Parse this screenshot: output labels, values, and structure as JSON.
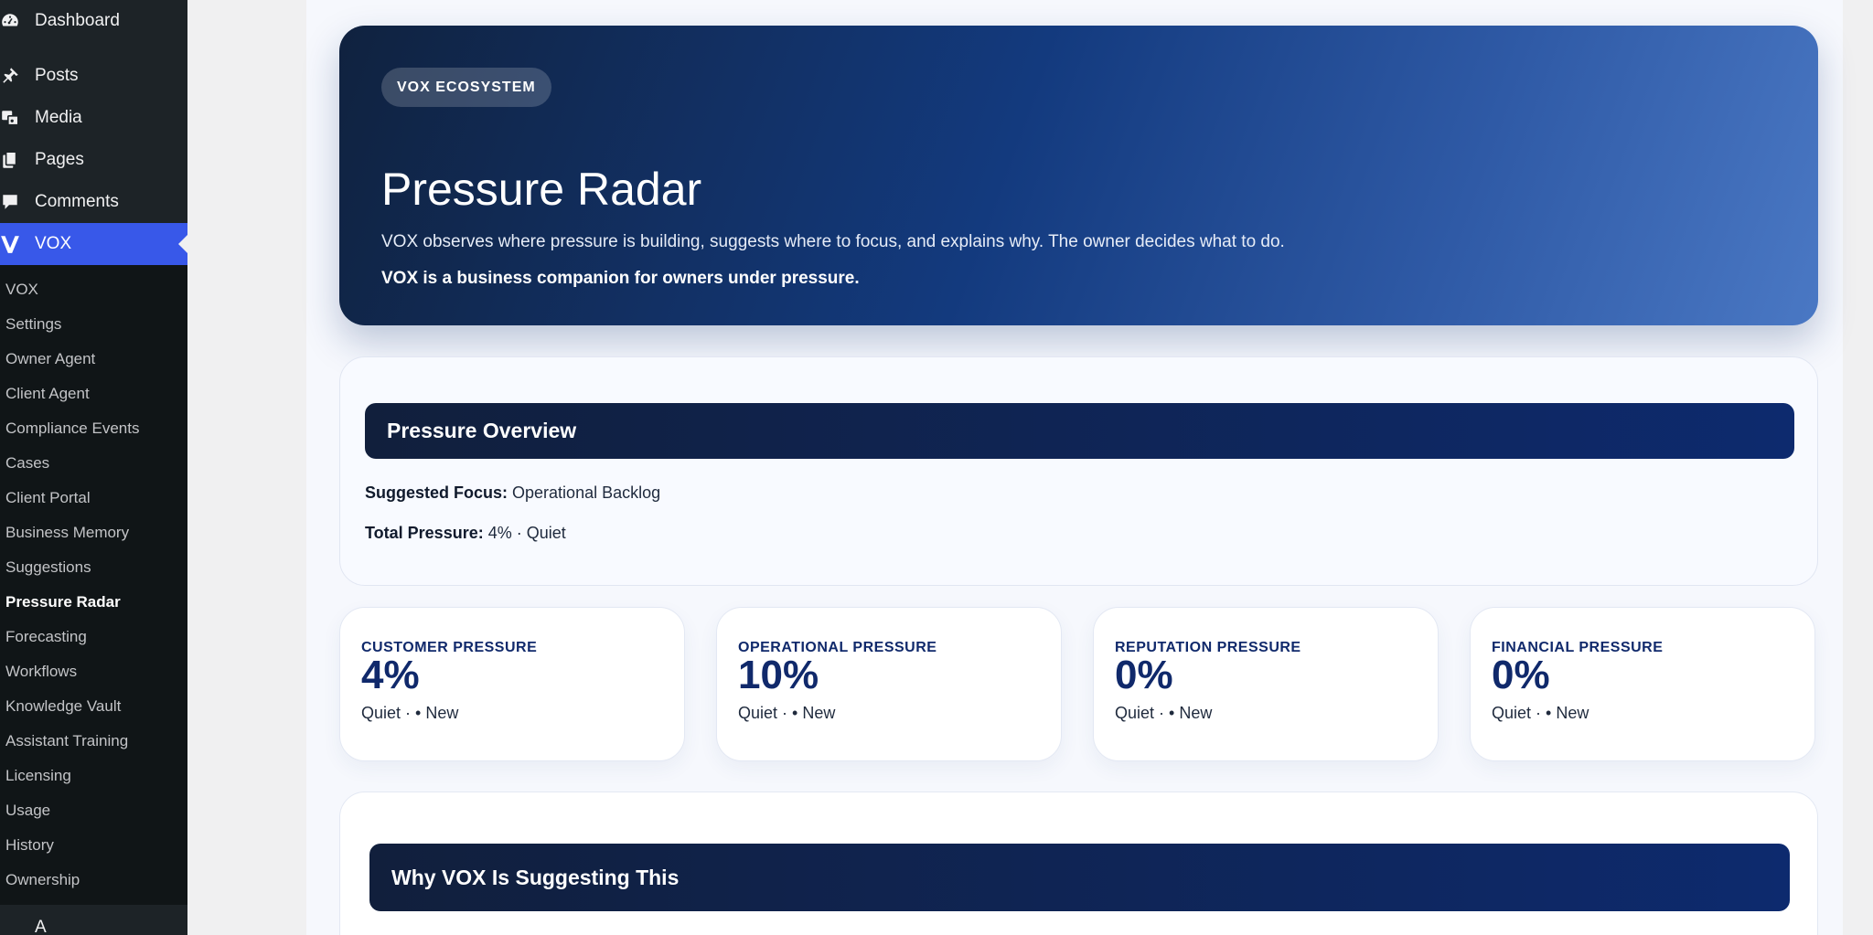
{
  "sidebar": {
    "top_items": [
      {
        "label": "Dashboard",
        "icon": "dashboard-icon"
      },
      {
        "label": "Posts",
        "icon": "pin-icon"
      },
      {
        "label": "Media",
        "icon": "media-icon"
      },
      {
        "label": "Pages",
        "icon": "pages-icon"
      },
      {
        "label": "Comments",
        "icon": "comment-icon"
      },
      {
        "label": "VOX",
        "icon": "vox-logo-icon"
      }
    ],
    "sub_items": [
      "VOX",
      "Settings",
      "Owner Agent",
      "Client Agent",
      "Compliance Events",
      "Cases",
      "Client Portal",
      "Business Memory",
      "Suggestions",
      "Pressure Radar",
      "Forecasting",
      "Workflows",
      "Knowledge Vault",
      "Assistant Training",
      "Licensing",
      "Usage",
      "History",
      "Ownership"
    ],
    "current_sub": "Pressure Radar",
    "bottom_item": "A"
  },
  "hero": {
    "badge": "VOX ECOSYSTEM",
    "title": "Pressure Radar",
    "description": "VOX observes where pressure is building, suggests where to focus, and explains why. The owner decides what to do.",
    "strong": "VOX is a business companion for owners under pressure."
  },
  "overview": {
    "title": "Pressure Overview",
    "focus_label": "Suggested Focus:",
    "focus_value": "Operational Backlog",
    "total_label": "Total Pressure:",
    "total_value": "4% · Quiet"
  },
  "cards": [
    {
      "label": "CUSTOMER PRESSURE",
      "value": "4%",
      "status": "Quiet · • New"
    },
    {
      "label": "OPERATIONAL PRESSURE",
      "value": "10%",
      "status": "Quiet · • New"
    },
    {
      "label": "REPUTATION PRESSURE",
      "value": "0%",
      "status": "Quiet · • New"
    },
    {
      "label": "FINANCIAL PRESSURE",
      "value": "0%",
      "status": "Quiet · • New"
    }
  ],
  "why": {
    "title": "Why VOX Is Suggesting This"
  },
  "colors": {
    "sidebar_bg": "#1d2327",
    "submenu_bg": "#101517",
    "active_item": "#3858e9",
    "accent_navy": "#10296b"
  }
}
